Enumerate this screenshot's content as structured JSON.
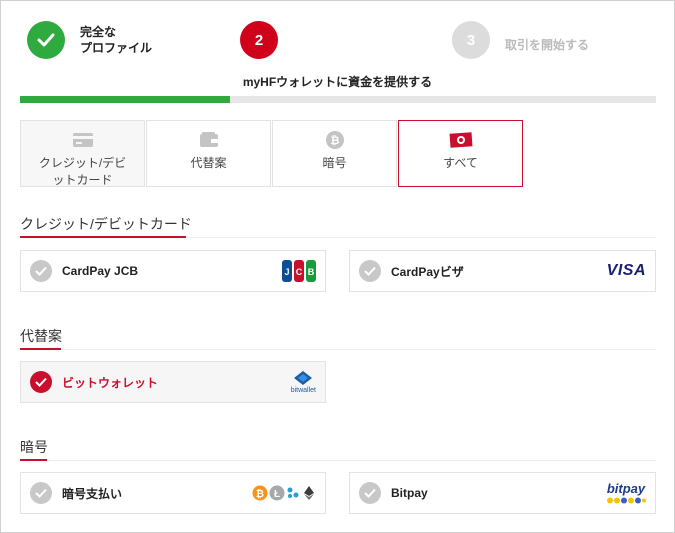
{
  "stepper": {
    "steps": [
      {
        "number": "",
        "label": "完全な\nプロファイル",
        "state": "done"
      },
      {
        "number": "2",
        "label": "",
        "state": "active"
      },
      {
        "number": "3",
        "label": "取引を開始する",
        "state": "pending"
      }
    ],
    "current_caption": "myHFウォレットに資金を提供する",
    "progress_fraction": 0.33
  },
  "tabs": [
    {
      "label": "クレジット/デビットカード",
      "icon": "credit-card-icon"
    },
    {
      "label": "代替案",
      "icon": "wallet-icon"
    },
    {
      "label": "暗号",
      "icon": "bitcoin-icon"
    },
    {
      "label": "すべて",
      "icon": "cash-icon",
      "selected": true
    }
  ],
  "sections": {
    "cards": {
      "title": "クレジット/デビットカード",
      "items": [
        {
          "label": "CardPay JCB",
          "logo": "jcb-logo"
        },
        {
          "label": "CardPayビザ",
          "logo": "visa-logo",
          "logo_text": "VISA"
        }
      ]
    },
    "alternative": {
      "title": "代替案",
      "items": [
        {
          "label": "ビットウォレット",
          "logo": "bitwallet-logo",
          "logo_text": "bitwallet",
          "selected": true
        }
      ]
    },
    "crypto": {
      "title": "暗号",
      "items": [
        {
          "label": "暗号支払い",
          "logo": "crypto-coins-logo"
        },
        {
          "label": "Bitpay",
          "logo": "bitpay-logo",
          "logo_text": "bitpay"
        }
      ]
    }
  },
  "colors": {
    "brand_red": "#c8102e",
    "success_green": "#2eaa3f",
    "inactive_grey": "#c8c8c8"
  }
}
